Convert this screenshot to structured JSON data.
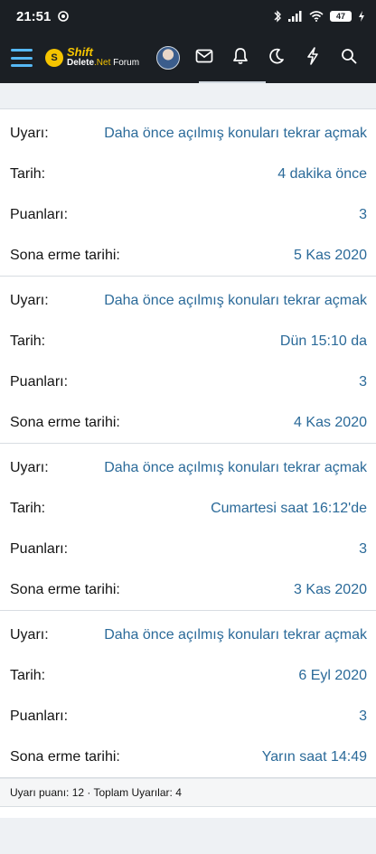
{
  "status_bar": {
    "time": "21:51",
    "battery": "47"
  },
  "header": {
    "logo_shift": "Shift",
    "logo_delete": "Delete",
    "logo_net": ".Net",
    "logo_forum": "Forum",
    "logo_mark": "S"
  },
  "warnings": [
    {
      "warning_label": "Uyarı:",
      "warning_value": "Daha önce açılmış konuları tekrar açmak",
      "date_label": "Tarih:",
      "date_value": "4 dakika önce",
      "points_label": "Puanları:",
      "points_value": "3",
      "expiry_label": "Sona erme tarihi:",
      "expiry_value": "5 Kas 2020"
    },
    {
      "warning_label": "Uyarı:",
      "warning_value": "Daha önce açılmış konuları tekrar açmak",
      "date_label": "Tarih:",
      "date_value": "Dün 15:10 da",
      "points_label": "Puanları:",
      "points_value": "3",
      "expiry_label": "Sona erme tarihi:",
      "expiry_value": "4 Kas 2020"
    },
    {
      "warning_label": "Uyarı:",
      "warning_value": "Daha önce açılmış konuları tekrar açmak",
      "date_label": "Tarih:",
      "date_value": "Cumartesi saat 16:12'de",
      "points_label": "Puanları:",
      "points_value": "3",
      "expiry_label": "Sona erme tarihi:",
      "expiry_value": "3 Kas 2020"
    },
    {
      "warning_label": "Uyarı:",
      "warning_value": "Daha önce açılmış konuları tekrar açmak",
      "date_label": "Tarih:",
      "date_value": "6 Eyl 2020",
      "points_label": "Puanları:",
      "points_value": "3",
      "expiry_label": "Sona erme tarihi:",
      "expiry_value": "Yarın saat 14:49"
    }
  ],
  "summary": "Uyarı puanı: 12 · Toplam Uyarılar: 4",
  "colors": {
    "header_bg": "#1b1f24",
    "link": "#2b6a99",
    "accent": "#56b8f5",
    "logo_yellow": "#f5c400"
  }
}
